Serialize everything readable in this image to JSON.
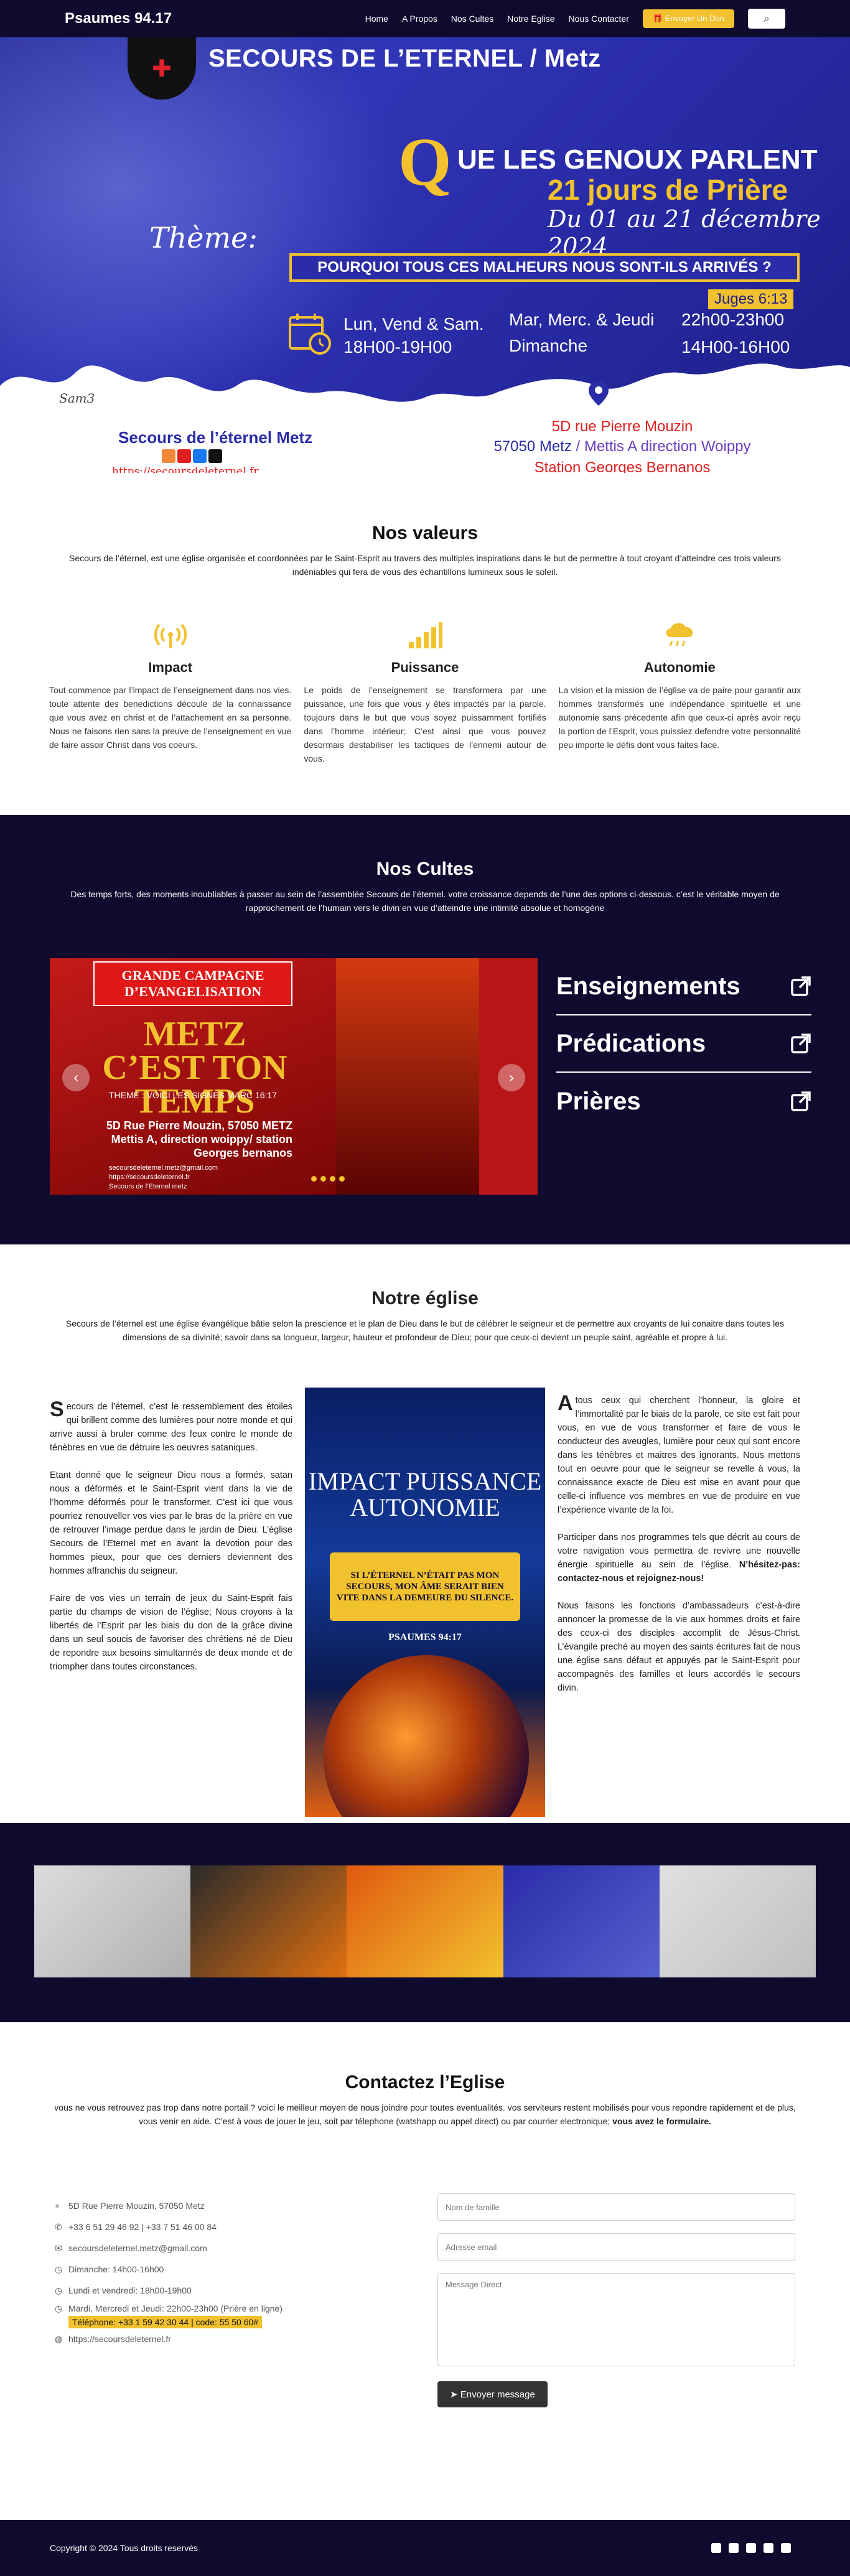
{
  "nav": {
    "brand": "Psaumes 94.17",
    "links": [
      "Home",
      "A Propos",
      "Nos Cultes",
      "Notre Eglise",
      "Nous Contacter"
    ],
    "don_label": "Envoyer Un Don",
    "search_icon": "search-icon"
  },
  "hero": {
    "title": "SECOURS DE L’ETERNEL  / Metz",
    "genoux": "UE LES GENOUX PARLENT",
    "q_letter": "Q",
    "jours": "21 jours de Prière",
    "dates": "Du 01   au 21 décembre 2024",
    "theme": "Thème:",
    "question": "POURQUOI TOUS CES MALHEURS NOUS SONT-ILS ARRIVÉS ?",
    "juges": "Juges 6:13",
    "sched1_day": "Lun, Vend & Sam.",
    "sched1_time": "18H00-19H00",
    "sched2_day": "Mar, Merc. & Jeudi",
    "sched2_time": "22h00-23h00",
    "sched3_day": "Dimanche",
    "sched3_time": "14H00-16H00",
    "sig": "Sam3",
    "sec_metz": "Secours de l’éternel Metz",
    "site": "https://secoursdeleternel.fr",
    "addr1": "5D rue Pierre Mouzin",
    "addr2a": "57050 Metz",
    "addr2b": " / Mettis A direction Woippy",
    "addr3": "Station Georges Bernanos",
    "colors": {
      "primary": "#2a2ca8",
      "accent": "#f2c12e",
      "red": "#e02020",
      "navy": "#0e0b2e"
    }
  },
  "values": {
    "title": "Nos valeurs",
    "subtitle": "Secours de l’éternel, est une église organisée et coordonnées par le Saint-Esprit au travers des multiples inspirations dans le but de permettre à tout croyant d’atteindre ces trois valeurs indéniables qui fera de vous des échantillons lumineux sous le soleil.",
    "cols": [
      {
        "icon": "broadcast-icon",
        "title": "Impact",
        "text": "Tout commence par l’impact de l’enseignement dans nos vies. toute attente des benedictions découle de la connaissance que vous avez en christ et de l’attachement en sa personne. Nous ne faisons rien sans la preuve de l’enseignement en vue de faire assoir Christ dans vos coeurs."
      },
      {
        "icon": "signal-bars-icon",
        "title": "Puissance",
        "text": "Le poids de l’enseignement se transformera par une puissance, une fois que vous y êtes impactés par la parole. toujours dans le but que vous soyez puissamment fortifiés dans l’homme intérieur; C’est ainsi que vous pouvez desormais destabiliser les tactiques de l’ennemi autour de vous."
      },
      {
        "icon": "cloud-rain-icon",
        "title": "Autonomie",
        "text": "La vision et la mission de l’église va de paire pour garantir aux hommes transformés une indépendance spirituelle et une autonomie sans précedente afin que ceux-ci après avoir reçu la portion de l’Esprit, vous puissiez defendre votre personnalité peu importe le défis dont vous faites face."
      }
    ]
  },
  "cultes": {
    "title": "Nos Cultes",
    "subtitle": "Des temps forts, des moments inoubliables à passer au sein de l’assemblée Secours de l’éternel. votre croissance depends de l’une des options ci-dessous. c’est le véritable moyen de rapprochement de l’humain vers le divin en vue d’atteindre une intimité absolue et homogène",
    "banner": "GRANDE CAMPAGNE D’EVANGELISATION",
    "big": "METZ C’EST TON TEMPS",
    "theme_line": "THEME : VOICI LES SIGNES  MARC 16:17",
    "addr_line": "5D Rue Pierre Mouzin, 57050 METZ Mettis A, direction woippy/ station Georges bernanos",
    "contact_lines": [
      "secoursdeleternel.metz@gmail.com",
      "https://secoursdeleternel.fr",
      "Secours de l’Eternel metz"
    ],
    "items": [
      "Enseignements",
      "Prédications",
      "Prières"
    ]
  },
  "eglise": {
    "title": "Notre église",
    "subtitle": "Secours de l’éternel est une église évangélique bâtie selon la prescience et le plan de Dieu dans le but de célébrer le seigneur et de permettre aux croyants de lui conaitre dans toutes les dimensions de sa divinité; savoir dans sa longueur, largeur, hauteur et profondeur de Dieu; pour que ceux-ci devient un peuple saint, agréable et propre à lui.",
    "left_drop": "S",
    "left_p1": "ecours de l’éternel, c’est le ressemblement des étoiles qui brillent comme des lumières pour notre monde et qui arrive aussi à bruler comme des feux contre le monde de ténèbres en vue de détruire les oeuvres sataniques.",
    "left_p2": "Etant donné que le seigneur Dieu nous a formés, satan nous a déformés et le Saint-Esprit vient dans la vie de l’homme déformés pour le transformer. C’est ici que vous pourriez renouveller vos vies par le bras de la prière en vue de retrouver l’image perdue dans le jardin de Dieu. L’église Secours de l’Eternel met en avant la devotion pour des hommes pieux, pour que ces derniers deviennent des hommes affranchis du seigneur.",
    "left_p3": "Faire de vos vies un terrain de jeux du Saint-Esprit fais partie du champs de vision de l’église; Nous croyons à la libertés de l’Esprit par les biais du don de la grâce divine dans un seul soucis de favoriser des chrétiens né de Dieu de repondre aux besoins simultannés de deux monde et de triompher dans toutes circonstances.",
    "right_drop": "A",
    "right_p1": " tous ceux qui cherchent l’honneur, la gloire et l’immortalité par le biais de la parole, ce site est fait pour vous, en vue de vous transformer et faire de vous le conducteur des aveugles, lumière pour ceux qui sont encore dans les ténèbres et maitres des ignorants. Nous mettons tout en oeuvre pour que le seigneur se revelle à vous, la connaissance exacte de Dieu est mise en avant pour que celle-ci influence vos membres en vue de produire en vue l’expérience vivante de la foi.",
    "right_p2a": "Participer dans nos programmes tels que décrit au cours de votre navigation vous permettra de revivre une nouvelle énergie spirituelle au sein de l’église.",
    "right_p2b": " N’hésitez-pas: contactez-nous et rejoignez-nous!",
    "right_p3": "Nous faisons les fonctions d’ambassadeurs c’est-à-dire annoncer la promesse de la vie aux hommes droits et faire des ceux-ci des disciples accomplit de Jésus-Christ. L’évangile preché au moyen des saints écritures fait de nous une église sans défaut et appuyés par le Saint-Esprit pour accompagnés des familles et leurs accordés le secours divin.",
    "poster_title": "IMPACT PUISSANCE AUTONOMIE",
    "poster_box": "SI L’ÉTERNEL N’ÉTAIT PAS MON SECOURS, MON ÂME SERAIT BIEN VITE DANS LA DEMEURE DU SILENCE.",
    "poster_ref": "PSAUMES 94:17"
  },
  "contact": {
    "title": "Contactez l’Eglise",
    "subtitle": "vous ne vous retrouvez pas trop dans notre portail ? voici le meilleur moyen de nous joindre pour toutes eventualités. vos serviteurs restent mobilisés pour vous repondre rapidement et de plus, vous venir en aide. C’est à vous de jouer le jeu, soit par télephone (watshapp ou appel direct) ou par courrier electronique;",
    "subtitle_bold": " vous avez le formulaire.",
    "rows": [
      {
        "icon": "map-pin-icon",
        "text": "5D Rue Pierre Mouzin, 57050 Metz"
      },
      {
        "icon": "phone-icon",
        "text": "+33 6 51 29 46 92 | +33 7 51 46 00 84"
      },
      {
        "icon": "envelope-icon",
        "text": "secoursdeleternel.metz@gmail.com"
      },
      {
        "icon": "clock-icon",
        "text": "Dimanche: 14h00-16h00"
      },
      {
        "icon": "clock-icon",
        "text": "Lundi et vendredi: 18h00-19h00"
      },
      {
        "icon": "clock-icon",
        "text": "Mardi, Mercredi et Jeudi: 22h00-23h00 (Prière en ligne)"
      }
    ],
    "highlight": "Téléphone: +33 1 59 42 30 44 | code: 55 50 60#",
    "website_icon": "globe-icon",
    "website": "https://secoursdeleternel.fr",
    "form": {
      "name_placeholder": "Nom de famille",
      "email_placeholder": "Adresse email",
      "message_placeholder": "Message Direct",
      "submit": "Envoyer message"
    }
  },
  "footer": {
    "copy": "Copyright © 2024 Tous droits reservés",
    "icons": [
      "instagram-icon",
      "facebook-icon",
      "twitter-icon",
      "tiktok-icon",
      "youtube-icon"
    ]
  }
}
